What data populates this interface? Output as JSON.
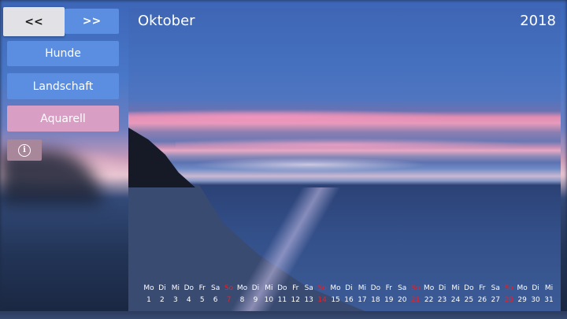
{
  "nav": {
    "prev_label": "<<",
    "next_label": ">>"
  },
  "categories": [
    {
      "label": "Hunde",
      "color": "#5b8de0"
    },
    {
      "label": "Landschaft",
      "color": "#5b8de0"
    },
    {
      "label": "Aquarell",
      "color": "#d99ec4"
    }
  ],
  "info_icon": "info-circle-icon",
  "calendar": {
    "month": "Oktober",
    "year": "2018",
    "sunday_color": "#e8202a",
    "days": [
      {
        "w": "Mo",
        "n": "1"
      },
      {
        "w": "Di",
        "n": "2"
      },
      {
        "w": "Mi",
        "n": "3"
      },
      {
        "w": "Do",
        "n": "4"
      },
      {
        "w": "Fr",
        "n": "5"
      },
      {
        "w": "Sa",
        "n": "6"
      },
      {
        "w": "So",
        "n": "7"
      },
      {
        "w": "Mo",
        "n": "8"
      },
      {
        "w": "Di",
        "n": "9"
      },
      {
        "w": "Mi",
        "n": "10"
      },
      {
        "w": "Do",
        "n": "11"
      },
      {
        "w": "Fr",
        "n": "12"
      },
      {
        "w": "Sa",
        "n": "13"
      },
      {
        "w": "So",
        "n": "14"
      },
      {
        "w": "Mo",
        "n": "15"
      },
      {
        "w": "Di",
        "n": "16"
      },
      {
        "w": "Mi",
        "n": "17"
      },
      {
        "w": "Do",
        "n": "18"
      },
      {
        "w": "Fr",
        "n": "19"
      },
      {
        "w": "Sa",
        "n": "20"
      },
      {
        "w": "So",
        "n": "21"
      },
      {
        "w": "Mo",
        "n": "22"
      },
      {
        "w": "Di",
        "n": "23"
      },
      {
        "w": "Mi",
        "n": "24"
      },
      {
        "w": "Do",
        "n": "25"
      },
      {
        "w": "Fr",
        "n": "26"
      },
      {
        "w": "Sa",
        "n": "27"
      },
      {
        "w": "So",
        "n": "28"
      },
      {
        "w": "Mo",
        "n": "29"
      },
      {
        "w": "Di",
        "n": "30"
      },
      {
        "w": "Mi",
        "n": "31"
      }
    ]
  }
}
